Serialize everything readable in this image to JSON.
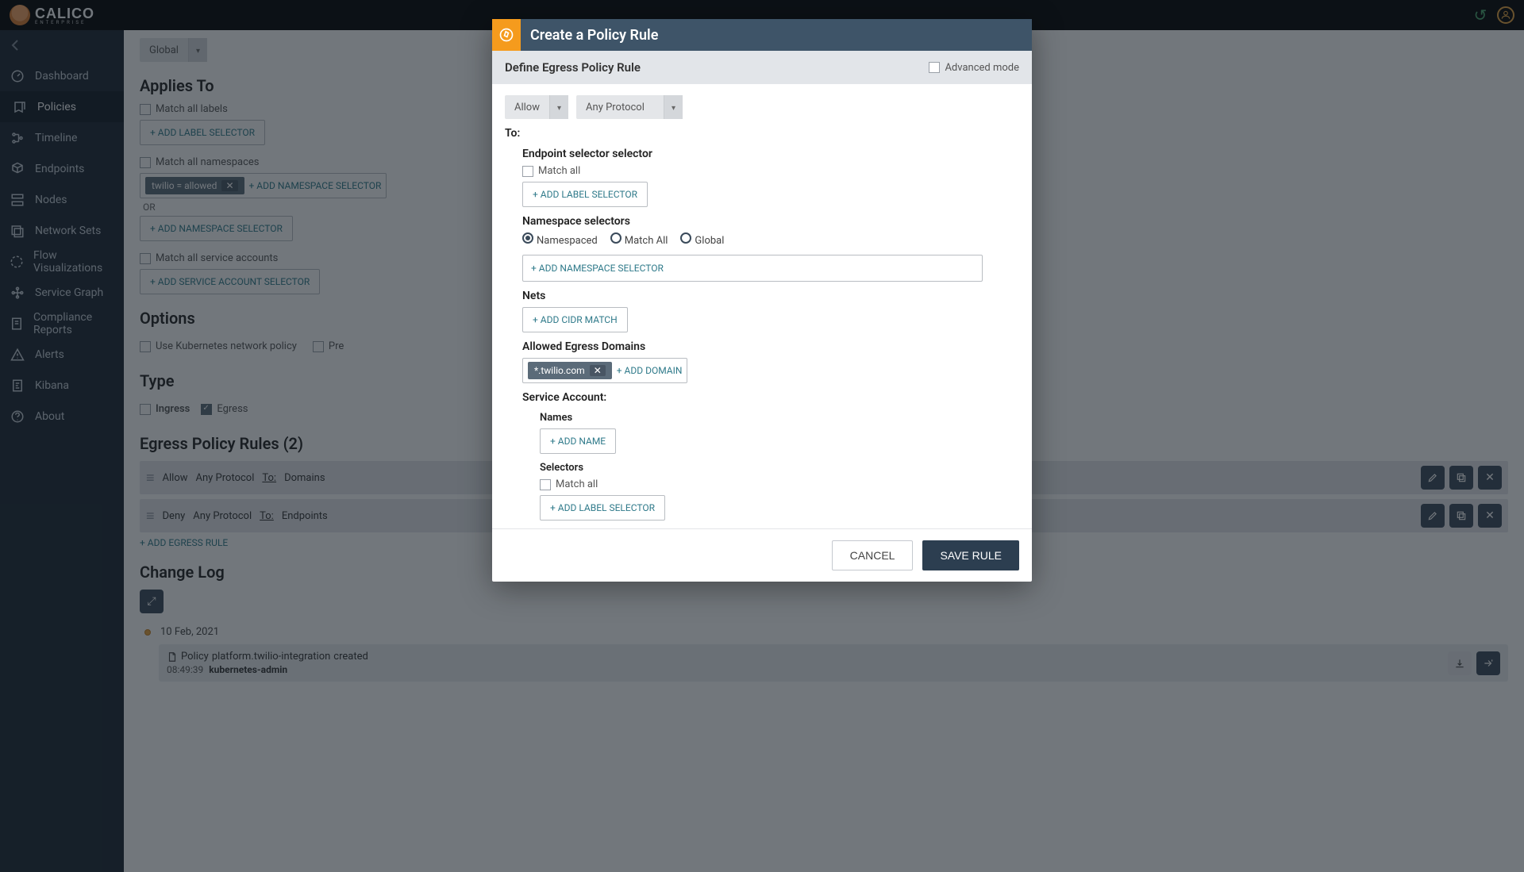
{
  "brand": {
    "name": "CALICO",
    "sub": "ENTERPRISE"
  },
  "nav": [
    {
      "id": "dashboard",
      "label": "Dashboard"
    },
    {
      "id": "policies",
      "label": "Policies",
      "active": true
    },
    {
      "id": "timeline",
      "label": "Timeline"
    },
    {
      "id": "endpoints",
      "label": "Endpoints"
    },
    {
      "id": "nodes",
      "label": "Nodes"
    },
    {
      "id": "networksets",
      "label": "Network Sets"
    },
    {
      "id": "flowviz",
      "label": "Flow Visualizations"
    },
    {
      "id": "servicegraph",
      "label": "Service Graph"
    },
    {
      "id": "compliance",
      "label": "Compliance Reports"
    },
    {
      "id": "alerts",
      "label": "Alerts"
    },
    {
      "id": "kibana",
      "label": "Kibana"
    },
    {
      "id": "about",
      "label": "About"
    }
  ],
  "page": {
    "scope_selector": "Global",
    "sections": {
      "applies_to": "Applies To",
      "options": "Options",
      "type": "Type",
      "egress_rules": "Egress Policy Rules (2)",
      "change_log": "Change Log"
    },
    "applies": {
      "match_all_labels": "Match all labels",
      "add_label_selector": "+ ADD LABEL SELECTOR",
      "match_all_namespaces": "Match all namespaces",
      "ns_chip": "twilio = allowed",
      "add_ns_selector_inline": "+ ADD NAMESPACE SELECTOR",
      "or": "OR",
      "add_ns_selector": "+ ADD NAMESPACE SELECTOR",
      "match_all_sa": "Match all service accounts",
      "add_sa_selector": "+ ADD SERVICE ACCOUNT SELECTOR"
    },
    "options": {
      "use_k8s": "Use Kubernetes network policy",
      "pre_truncated": "Pre"
    },
    "type": {
      "ingress": "Ingress",
      "egress": "Egress"
    },
    "egress_rules": [
      {
        "action": "Allow",
        "proto": "Any Protocol",
        "to_label": "To:",
        "target": "Domains"
      },
      {
        "action": "Deny",
        "proto": "Any Protocol",
        "to_label": "To:",
        "target": "Endpoints"
      }
    ],
    "add_egress_rule": "+ ADD EGRESS RULE",
    "log": {
      "date": "10 Feb, 2021",
      "line_prefix": "Policy ",
      "policy_name": "platform.twilio-integration",
      "line_suffix": " created",
      "time": "08:49:39",
      "user": "kubernetes-admin"
    }
  },
  "modal": {
    "title": "Create a Policy Rule",
    "subtitle": "Define Egress Policy Rule",
    "advanced": "Advanced mode",
    "action_selector": "Allow",
    "protocol_selector": "Any Protocol",
    "to_label": "To:",
    "endpoint_selector": {
      "heading": "Endpoint selector selector",
      "match_all": "Match all",
      "add_label": "+ ADD LABEL SELECTOR"
    },
    "namespace": {
      "heading": "Namespace selectors",
      "namespaced": "Namespaced",
      "match_all": "Match All",
      "global": "Global",
      "add": "+ ADD NAMESPACE SELECTOR"
    },
    "nets": {
      "heading": "Nets",
      "add": "+ ADD CIDR MATCH"
    },
    "domains": {
      "heading": "Allowed Egress Domains",
      "chip": "*.twilio.com",
      "add": "+ ADD DOMAIN"
    },
    "service_account": {
      "heading": "Service Account:",
      "names": "Names",
      "add_name": "+ ADD NAME",
      "selectors": "Selectors",
      "match_all": "Match all",
      "add_label": "+ ADD LABEL SELECTOR"
    },
    "cancel": "CANCEL",
    "save": "SAVE RULE"
  }
}
